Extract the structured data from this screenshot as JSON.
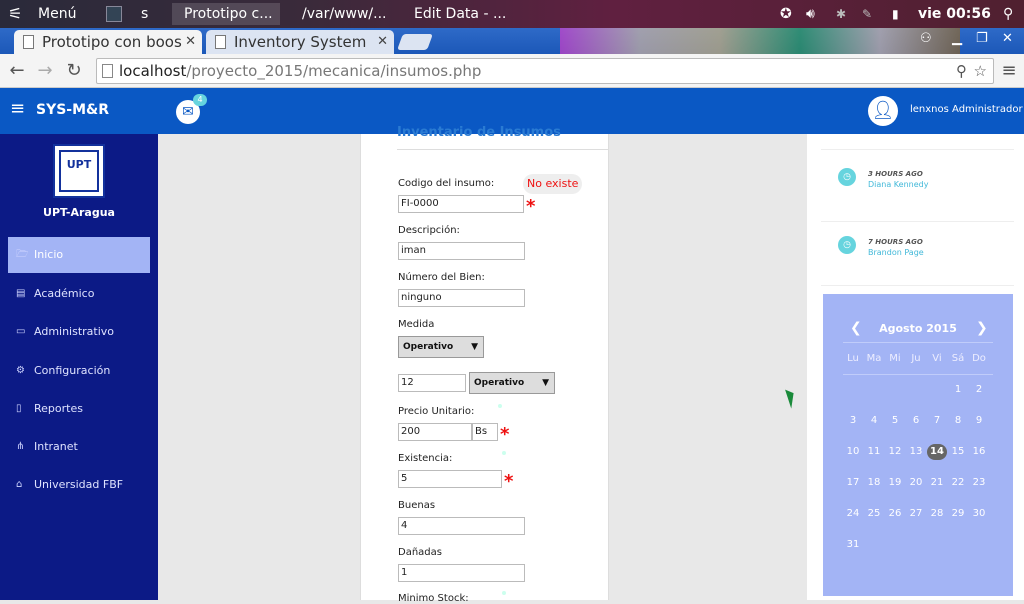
{
  "taskbar": {
    "menu_label": "Menú",
    "item2": "s",
    "item3": "Prototipo c...",
    "item4": "/var/www/...",
    "item5": "Edit Data - ...",
    "clock": "vie 00:56"
  },
  "tabs": [
    {
      "label": "Prototipo con boos"
    },
    {
      "label": "Inventory System"
    }
  ],
  "address": {
    "host": "localhost",
    "path": "/proyecto_2015/mecanica/insumos.php"
  },
  "app": {
    "brand": "SYS-M&R",
    "mail_count": "4",
    "user_name": "lenxnos Administrador"
  },
  "sidebar": {
    "logo_text": "UPT",
    "org_name": "UPT-Aragua",
    "items": [
      {
        "label": "Inicio",
        "icon": "folder-icon"
      },
      {
        "label": "Académico",
        "icon": "book-icon"
      },
      {
        "label": "Administrativo",
        "icon": "monitor-icon"
      },
      {
        "label": "Configuración",
        "icon": "cogs-icon"
      },
      {
        "label": "Reportes",
        "icon": "file-icon"
      },
      {
        "label": "Intranet",
        "icon": "sitemap-icon"
      },
      {
        "label": "Universidad FBF",
        "icon": "bank-icon"
      }
    ]
  },
  "form": {
    "title": "Inventario de Insumos",
    "codigo_label": "Codigo del insumo:",
    "codigo_value": "FI-0000",
    "status_badge": "No existe",
    "descripcion_label": "Descripción:",
    "descripcion_value": "iman",
    "numero_label": "Número del Bien:",
    "numero_value": "ninguno",
    "medida_label": "Medida",
    "medida_select": "Operativo",
    "cantidad_value": "12",
    "medida_select2": "Operativo",
    "precio_label": "Precio Unitario:",
    "precio_value": "200",
    "moneda_value": "Bs",
    "existencia_label": "Existencia:",
    "existencia_value": "5",
    "buenas_label": "Buenas",
    "buenas_value": "4",
    "danadas_label": "Dañadas",
    "danadas_value": "1",
    "minimo_label": "Minimo Stock:"
  },
  "activity": [
    {
      "time": "3 HOURS AGO",
      "name": "Diana Kennedy"
    },
    {
      "time": "7 HOURS AGO",
      "name": "Brandon Page"
    }
  ],
  "calendar": {
    "month": "Agosto 2015",
    "weekdays": [
      "Lu",
      "Ma",
      "Mi",
      "Ju",
      "Vi",
      "Sá",
      "Do"
    ],
    "today": "14",
    "days": [
      "1",
      "2",
      "3",
      "4",
      "5",
      "6",
      "7",
      "8",
      "9",
      "10",
      "11",
      "12",
      "13",
      "14",
      "15",
      "16",
      "17",
      "18",
      "19",
      "20",
      "21",
      "22",
      "23",
      "24",
      "25",
      "26",
      "27",
      "28",
      "29",
      "30",
      "31"
    ]
  },
  "colors": {
    "appbar": "#0a58c4",
    "sidebar": "#0c1a86",
    "active": "#a3b4f5",
    "required": "#e11111"
  }
}
